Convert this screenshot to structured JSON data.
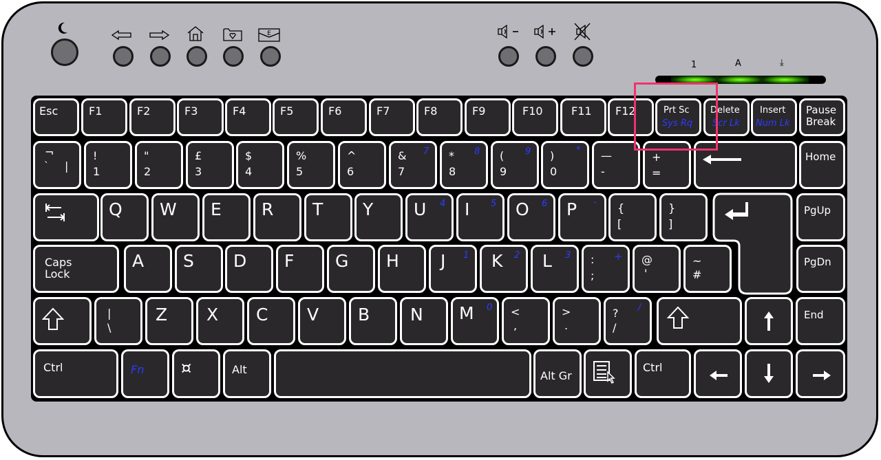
{
  "media": {
    "power": {
      "icon": "moon-icon",
      "label": "sleep"
    },
    "buttons": [
      {
        "icon": "back-arrow-icon",
        "label": "back"
      },
      {
        "icon": "forward-arrow-icon",
        "label": "forward"
      },
      {
        "icon": "home-icon",
        "label": "home"
      },
      {
        "icon": "favorites-folder-icon",
        "label": "favorites"
      },
      {
        "icon": "email-icon",
        "label": "E"
      }
    ],
    "volume": [
      {
        "icon": "volume-down-icon",
        "sign": "−"
      },
      {
        "icon": "volume-up-icon",
        "sign": "+"
      },
      {
        "icon": "mute-icon",
        "sign": ""
      }
    ]
  },
  "indicators": [
    {
      "label": "1",
      "name": "num-lock",
      "on": true
    },
    {
      "label": "A",
      "name": "caps-lock",
      "on": true
    },
    {
      "label": "⤓",
      "name": "scroll-lock",
      "on": true
    }
  ],
  "colors": {
    "key": "#2b282c",
    "body": "#b8b7bd",
    "fn_blue": "#2a3cff",
    "highlight": "#f0336b",
    "led": "#5cff1a"
  },
  "highlight": {
    "target": "Prt Sc / Sys Rq"
  },
  "rows": {
    "function": [
      {
        "main": "Esc"
      },
      {
        "main": "F1"
      },
      {
        "main": "F2"
      },
      {
        "main": "F3"
      },
      {
        "main": "F4"
      },
      {
        "main": "F5"
      },
      {
        "main": "F6"
      },
      {
        "main": "F7"
      },
      {
        "main": "F8"
      },
      {
        "main": "F9"
      },
      {
        "main": "F10"
      },
      {
        "main": "F11"
      },
      {
        "main": "F12"
      },
      {
        "main": "Prt Sc",
        "fn": "Sys Rq"
      },
      {
        "main": "Delete",
        "fn": "Scr Lk"
      },
      {
        "main": "Insert",
        "fn": "Num Lk"
      },
      {
        "main": "Pause",
        "sub": "Break"
      }
    ],
    "number": [
      {
        "top": "¬",
        "bottom": "`",
        "side": "|"
      },
      {
        "top": "!",
        "bottom": "1"
      },
      {
        "top": "\"",
        "bottom": "2"
      },
      {
        "top": "£",
        "bottom": "3"
      },
      {
        "top": "$",
        "bottom": "4"
      },
      {
        "top": "%",
        "bottom": "5"
      },
      {
        "top": "^",
        "bottom": "6"
      },
      {
        "top": "&",
        "bottom": "7",
        "fn": "7"
      },
      {
        "top": "*",
        "bottom": "8",
        "fn": "8"
      },
      {
        "top": "(",
        "bottom": "9",
        "fn": "9"
      },
      {
        "top": ")",
        "bottom": "0",
        "fn": "*"
      },
      {
        "top": "—",
        "bottom": "-"
      },
      {
        "top": "+",
        "bottom": "="
      },
      {
        "main": "Backspace",
        "icon": "backspace-arrow-icon"
      },
      {
        "main": "Home"
      }
    ],
    "qwerty": [
      {
        "main": "Tab",
        "icon": "tab-icon"
      },
      {
        "main": "Q"
      },
      {
        "main": "W"
      },
      {
        "main": "E"
      },
      {
        "main": "R"
      },
      {
        "main": "T"
      },
      {
        "main": "Y"
      },
      {
        "main": "U",
        "fn": "4"
      },
      {
        "main": "I",
        "fn": "5"
      },
      {
        "main": "O",
        "fn": "6"
      },
      {
        "main": "P",
        "fn": "-"
      },
      {
        "top": "{",
        "bottom": "["
      },
      {
        "top": "}",
        "bottom": "]"
      },
      {
        "main": "Enter",
        "icon": "enter-icon"
      },
      {
        "main": "PgUp"
      }
    ],
    "home": [
      {
        "main": "Caps",
        "sub": "Lock"
      },
      {
        "main": "A"
      },
      {
        "main": "S"
      },
      {
        "main": "D"
      },
      {
        "main": "F"
      },
      {
        "main": "G"
      },
      {
        "main": "H"
      },
      {
        "main": "J",
        "fn": "1"
      },
      {
        "main": "K",
        "fn": "2"
      },
      {
        "main": "L",
        "fn": "3"
      },
      {
        "top": ":",
        "bottom": ";",
        "fn": "+"
      },
      {
        "top": "@",
        "bottom": "'"
      },
      {
        "top": "~",
        "bottom": "#"
      },
      {
        "main": "PgDn"
      }
    ],
    "shift": [
      {
        "main": "Shift",
        "icon": "shift-icon"
      },
      {
        "top": "|",
        "bottom": "\\"
      },
      {
        "main": "Z"
      },
      {
        "main": "X"
      },
      {
        "main": "C"
      },
      {
        "main": "V"
      },
      {
        "main": "B"
      },
      {
        "main": "N"
      },
      {
        "main": "M",
        "fn": "0"
      },
      {
        "top": "<",
        "bottom": ","
      },
      {
        "top": ">",
        "bottom": "."
      },
      {
        "top": "?",
        "bottom": "/",
        "fn": "/"
      },
      {
        "main": "Shift",
        "icon": "shift-icon"
      },
      {
        "main": "Up",
        "icon": "arrow-up-icon"
      },
      {
        "main": "End"
      }
    ],
    "bottom": [
      {
        "main": "Ctrl"
      },
      {
        "fn": "Fn"
      },
      {
        "main": "Currency",
        "icon": "currency-icon",
        "glyph": "¤"
      },
      {
        "main": "Alt"
      },
      {
        "main": "Space"
      },
      {
        "main": "Alt Gr"
      },
      {
        "main": "Menu",
        "icon": "context-menu-icon"
      },
      {
        "main": "Ctrl"
      },
      {
        "main": "Left",
        "icon": "arrow-left-icon"
      },
      {
        "main": "Down",
        "icon": "arrow-down-icon"
      },
      {
        "main": "Right",
        "icon": "arrow-right-icon"
      }
    ]
  }
}
